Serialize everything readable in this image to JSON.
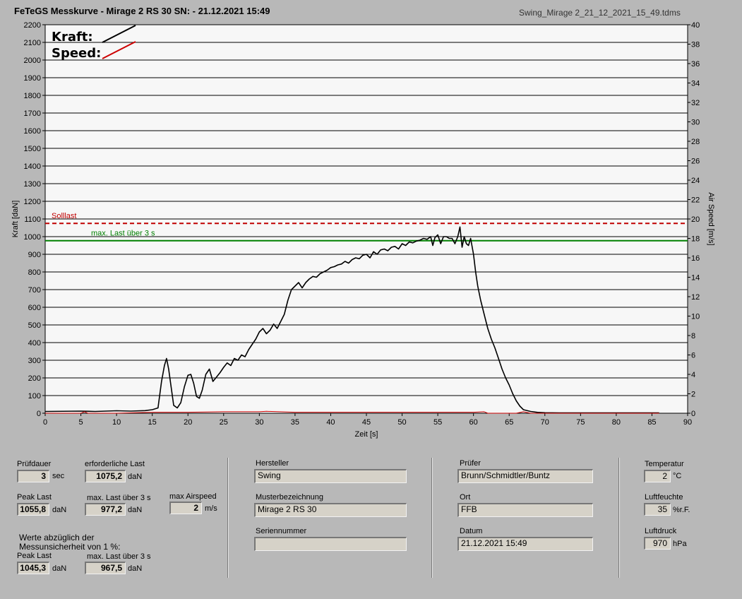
{
  "header": {
    "title": "FeTeGS Messkurve - Mirage 2 RS 30  SN:  - 21.12.2021 15:49",
    "file": "Swing_Mirage 2_21_12_2021_15_49.tdms"
  },
  "chart_data": {
    "type": "line",
    "xlabel": "Zeit [s]",
    "ylabel": "Kraft [daN]",
    "y2label": "Air Speed [m/s]",
    "xlim": [
      0,
      90
    ],
    "ylim": [
      0,
      2200
    ],
    "y2lim": [
      0,
      40
    ],
    "x_ticks": [
      0,
      5,
      10,
      15,
      20,
      25,
      30,
      35,
      40,
      45,
      50,
      55,
      60,
      65,
      70,
      75,
      80,
      85,
      90
    ],
    "y_ticks": [
      0,
      100,
      200,
      300,
      400,
      500,
      600,
      700,
      800,
      900,
      1000,
      1100,
      1200,
      1300,
      1400,
      1500,
      1600,
      1700,
      1800,
      1900,
      2000,
      2100,
      2200
    ],
    "y2_ticks": [
      0,
      2,
      4,
      6,
      8,
      10,
      12,
      14,
      16,
      18,
      20,
      22,
      24,
      26,
      28,
      30,
      32,
      34,
      36,
      38,
      40
    ],
    "grid": true,
    "legend": [
      {
        "name": "Kraft:",
        "color": "#000000"
      },
      {
        "name": "Speed:",
        "color": "#cc0000"
      }
    ],
    "reference_lines": [
      {
        "label": "Solllast",
        "value": 1075.2,
        "color": "#c00000",
        "style": "dashed"
      },
      {
        "label": "max. Last über  3 s",
        "value": 977.2,
        "color": "#008000",
        "style": "solid"
      }
    ],
    "series": [
      {
        "name": "Kraft",
        "color": "#000000",
        "axis": "left",
        "x": [
          0,
          5,
          7,
          10,
          12,
          14,
          15,
          15.8,
          16.3,
          16.7,
          17,
          17.3,
          17.6,
          18,
          18.5,
          19,
          19.5,
          20,
          20.4,
          20.8,
          21.2,
          21.6,
          22,
          22.5,
          23,
          23.5,
          24,
          24.5,
          25,
          25.5,
          26,
          26.5,
          27,
          27.5,
          28,
          28.5,
          29,
          29.5,
          30,
          30.5,
          31,
          31.5,
          32,
          32.5,
          33,
          33.5,
          34,
          34.5,
          35,
          35.5,
          36,
          36.5,
          37,
          37.5,
          38,
          38.5,
          39,
          39.5,
          40,
          40.5,
          41,
          41.5,
          42,
          42.5,
          43,
          43.5,
          44,
          44.5,
          45,
          45.5,
          46,
          46.5,
          47,
          47.5,
          48,
          48.5,
          49,
          49.5,
          50,
          50.5,
          51,
          51.5,
          52,
          52.5,
          53,
          53.5,
          54,
          54.3,
          54.6,
          55,
          55.4,
          55.8,
          56.2,
          56.6,
          57,
          57.4,
          57.8,
          58.1,
          58.4,
          58.7,
          59,
          59.3,
          59.6,
          60,
          60.3,
          60.6,
          61,
          61.5,
          62,
          62.5,
          63,
          63.5,
          64,
          64.5,
          65,
          65.5,
          66,
          66.5,
          67,
          68,
          69,
          70,
          72,
          75,
          80,
          86
        ],
        "values": [
          10,
          12,
          10,
          14,
          12,
          15,
          20,
          30,
          180,
          270,
          310,
          250,
          160,
          45,
          30,
          60,
          150,
          215,
          220,
          170,
          95,
          85,
          130,
          220,
          250,
          180,
          205,
          230,
          260,
          285,
          270,
          310,
          300,
          330,
          320,
          360,
          390,
          420,
          460,
          480,
          450,
          470,
          505,
          480,
          520,
          560,
          640,
          700,
          720,
          740,
          710,
          740,
          760,
          775,
          770,
          790,
          800,
          810,
          825,
          830,
          840,
          845,
          860,
          850,
          870,
          880,
          875,
          895,
          900,
          880,
          915,
          900,
          925,
          930,
          920,
          940,
          945,
          930,
          960,
          950,
          970,
          965,
          975,
          980,
          990,
          985,
          1000,
          950,
          995,
          1010,
          960,
          1000,
          1000,
          990,
          990,
          960,
          1000,
          1055,
          940,
          1000,
          960,
          950,
          990,
          900,
          800,
          720,
          640,
          560,
          480,
          420,
          370,
          310,
          250,
          200,
          160,
          110,
          70,
          40,
          20,
          10,
          5,
          3,
          2,
          2,
          2,
          2
        ]
      },
      {
        "name": "Speed",
        "color": "#cc0000",
        "axis": "right",
        "x": [
          0,
          5,
          5.5,
          6,
          8,
          10,
          15,
          20,
          25,
          30,
          31,
          35,
          40,
          45,
          50,
          55,
          60,
          61.5,
          62,
          66,
          67,
          68,
          86
        ],
        "values": [
          0,
          0,
          0.15,
          0,
          0,
          0,
          0.1,
          0.1,
          0.15,
          0.15,
          0.2,
          0.1,
          0.1,
          0.1,
          0.1,
          0.1,
          0.1,
          0.15,
          0,
          0,
          0.15,
          0,
          0
        ]
      }
    ]
  },
  "panel": {
    "pruefdauer_label": "Prüfdauer",
    "pruefdauer_value": "3",
    "pruefdauer_unit": "sec",
    "erf_last_label": "erforderliche Last",
    "erf_last_value": "1075,2",
    "erf_last_unit": "daN",
    "peak_last_label": "Peak Last",
    "peak_last_value": "1055,8",
    "peak_last_unit": "daN",
    "max_last_label": "max. Last über  3 s",
    "max_last_value": "977,2",
    "max_last_unit": "daN",
    "max_airspeed_label": "max Airspeed",
    "max_airspeed_value": "2",
    "max_airspeed_unit": "m/s",
    "werte_label_1": "Werte abzüglich der",
    "werte_label_2": "Messunsicherheit von 1  %:",
    "peak_last2_label": "Peak Last",
    "peak_last2_value": "1045,3",
    "peak_last2_unit": "daN",
    "max_last2_label": "max. Last über  3 s",
    "max_last2_value": "967,5",
    "max_last2_unit": "daN",
    "hersteller_label": "Hersteller",
    "hersteller_value": "Swing",
    "muster_label": "Musterbezeichnung",
    "muster_value": "Mirage 2 RS 30",
    "serien_label": "Seriennummer",
    "serien_value": "",
    "pruefer_label": "Prüfer",
    "pruefer_value": "Brunn/Schmidtler/Buntz",
    "ort_label": "Ort",
    "ort_value": "FFB",
    "datum_label": "Datum",
    "datum_value": "21.12.2021 15:49",
    "temp_label": "Temperatur",
    "temp_value": "2",
    "temp_unit": "°C",
    "feuchte_label": "Luftfeuchte",
    "feuchte_value": "35",
    "feuchte_unit": "%r.F.",
    "druck_label": "Luftdruck",
    "druck_value": "970",
    "druck_unit": "hPa"
  }
}
